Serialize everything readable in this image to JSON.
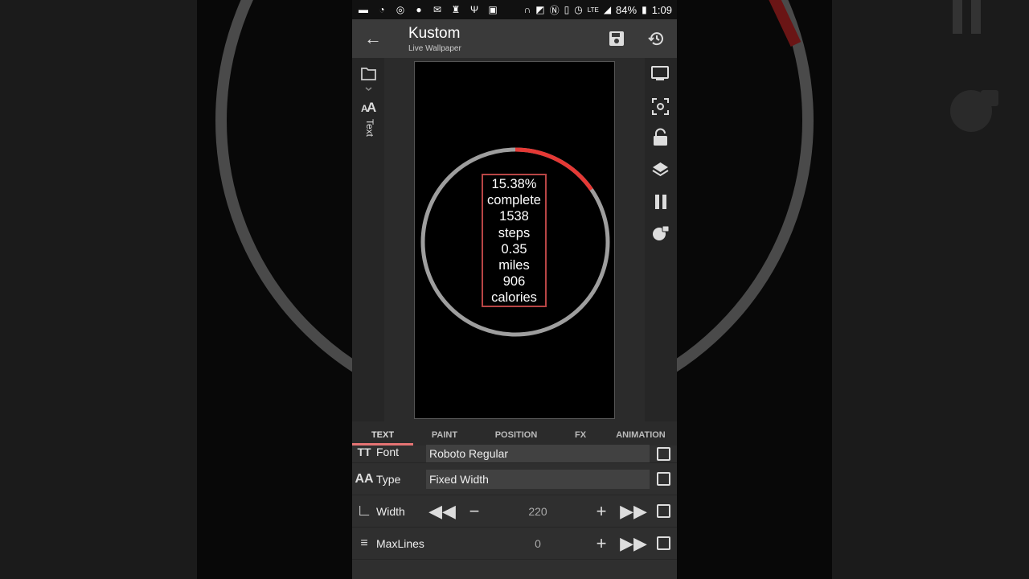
{
  "statusbar": {
    "battery": "84%",
    "time": "1:09",
    "network": "LTE"
  },
  "appbar": {
    "title": "Kustom",
    "subtitle": "Live Wallpaper"
  },
  "leftbar": {
    "item_label": "Text"
  },
  "canvas": {
    "progress_percent": 15.38,
    "accent_color": "#e53935",
    "stats_lines": [
      "15.38%",
      "complete",
      "1538",
      "steps",
      "0.35",
      "miles",
      "906",
      "calories"
    ]
  },
  "tabs": [
    "TEXT",
    "PAINT",
    "POSITION",
    "FX",
    "ANIMATION"
  ],
  "properties": {
    "font": {
      "label": "Font",
      "value": "Roboto Regular"
    },
    "type": {
      "label": "Type",
      "value": "Fixed Width"
    },
    "width": {
      "label": "Width",
      "value": "220"
    },
    "maxlines": {
      "label": "MaxLines",
      "value": "0"
    }
  }
}
